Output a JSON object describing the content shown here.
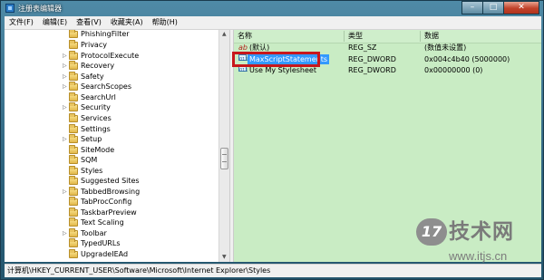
{
  "window": {
    "title": "注册表编辑器",
    "controls": {
      "minimize": "–",
      "maximize": "□",
      "close": "✕"
    }
  },
  "menu": [
    "文件(F)",
    "编辑(E)",
    "查看(V)",
    "收藏夹(A)",
    "帮助(H)"
  ],
  "tree": {
    "items": [
      {
        "label": "PhishingFilter",
        "expander": ""
      },
      {
        "label": "Privacy",
        "expander": ""
      },
      {
        "label": "ProtocolExecute",
        "expander": "▷"
      },
      {
        "label": "Recovery",
        "expander": "▷"
      },
      {
        "label": "Safety",
        "expander": "▷"
      },
      {
        "label": "SearchScopes",
        "expander": "▷"
      },
      {
        "label": "SearchUrl",
        "expander": ""
      },
      {
        "label": "Security",
        "expander": "▷"
      },
      {
        "label": "Services",
        "expander": ""
      },
      {
        "label": "Settings",
        "expander": ""
      },
      {
        "label": "Setup",
        "expander": "▷"
      },
      {
        "label": "SiteMode",
        "expander": ""
      },
      {
        "label": "SQM",
        "expander": ""
      },
      {
        "label": "Styles",
        "expander": ""
      },
      {
        "label": "Suggested Sites",
        "expander": ""
      },
      {
        "label": "TabbedBrowsing",
        "expander": "▷"
      },
      {
        "label": "TabProcConfig",
        "expander": ""
      },
      {
        "label": "TaskbarPreview",
        "expander": ""
      },
      {
        "label": "Text Scaling",
        "expander": ""
      },
      {
        "label": "Toolbar",
        "expander": "▷"
      },
      {
        "label": "TypedURLs",
        "expander": ""
      },
      {
        "label": "UpgradeIEAd",
        "expander": ""
      }
    ]
  },
  "values": {
    "headers": {
      "name": "名称",
      "type": "类型",
      "data": "数据"
    },
    "rows": [
      {
        "icon": "ab",
        "icon_name": "string-value-icon",
        "name": "(默认)",
        "type": "REG_SZ",
        "data": "(数值未设置)"
      },
      {
        "icon": "011",
        "icon_name": "dword-value-icon",
        "name": "MaxScriptStatements",
        "type": "REG_DWORD",
        "data": "0x004c4b40 (5000000)"
      },
      {
        "icon": "011",
        "icon_name": "dword-value-icon",
        "name": "Use My Stylesheet",
        "type": "REG_DWORD",
        "data": "0x00000000 (0)"
      }
    ]
  },
  "status": {
    "path": "计算机\\HKEY_CURRENT_USER\\Software\\Microsoft\\Internet Explorer\\Styles"
  },
  "watermark": {
    "badge": "17",
    "brand": "技术网",
    "url": "www.itjs.cn"
  },
  "colors": {
    "values_bg": "#c9ecc4",
    "highlight_box": "#c8171c",
    "selection": "#3399ff"
  }
}
